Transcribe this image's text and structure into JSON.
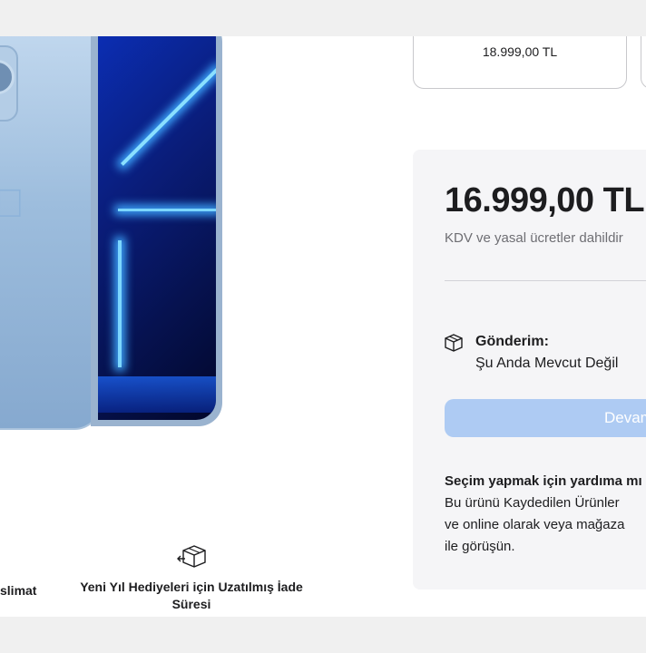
{
  "option_card": {
    "price": "18.999,00 TL"
  },
  "price_panel": {
    "price": "16.999,00 TL",
    "tax_note": "KDV ve yasal ücretler dahildir",
    "shipping_label": "Gönderim:",
    "shipping_status": "Şu Anda Mevcut Değil",
    "cta_label": "Devam",
    "help_title": "Seçim yapmak için yardıma mı",
    "help_lines": [
      "Bu ürünü Kaydedilen Ürünler",
      "ve online olarak veya mağaza",
      "ile görüşün."
    ]
  },
  "features": {
    "left_label": "slimat",
    "middle_label": "Yeni Yıl Hediyeleri için Uzatılmış İade Süresi",
    "middle_icon": "box-return-icon"
  },
  "colors": {
    "cta_disabled": "#aecbf3",
    "panel_bg": "#f5f5f7",
    "muted_text": "#6e6e73"
  }
}
